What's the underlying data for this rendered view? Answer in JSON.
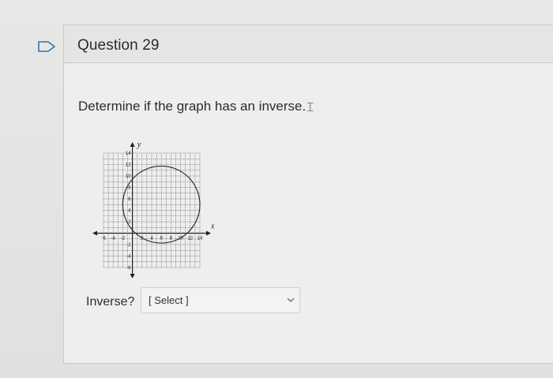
{
  "question": {
    "title": "Question 29",
    "prompt": "Determine if the graph has an inverse.",
    "answer_label": "Inverse?",
    "select_value": "[ Select ]"
  },
  "graph": {
    "axis_x_label": "x",
    "axis_y_label": "y",
    "x_ticks": [
      "-6",
      "-4",
      "-2",
      "2",
      "4",
      "6",
      "8",
      "10",
      "12",
      "14"
    ],
    "y_ticks": [
      "14",
      "12",
      "10",
      "8",
      "6",
      "4",
      "2",
      "-2",
      "-4",
      "-6"
    ],
    "circle_center": [
      6,
      5
    ],
    "circle_radius": 8
  },
  "icons": {
    "flag": "flag-icon",
    "chevron": "chevron-down-icon"
  },
  "colors": {
    "background": "#e4e5e3",
    "header": "#e5e6e4",
    "text": "#2b2b2b",
    "grid": "#4a4a4a"
  }
}
